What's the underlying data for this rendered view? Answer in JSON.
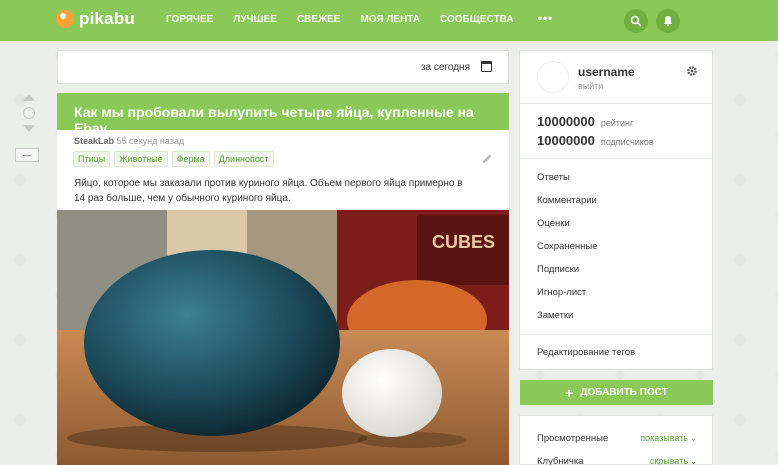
{
  "header": {
    "logo_text": "pikabu",
    "nav": [
      "ГОРЯЧЕЕ",
      "ЛУЧШЕЕ",
      "СВЕЖЕЕ",
      "МОЯ ЛЕНТА",
      "СООБЩЕСТВА"
    ],
    "nav_active": "СВЕЖЕЕ",
    "more": "•••",
    "accent_color": "#8ac858"
  },
  "datebar": {
    "label": "за сегодня",
    "icon": "calendar-icon"
  },
  "post": {
    "title": "Как мы пробовали вылупить четыре яйца, купленные на Ebay",
    "author": "SteakLab",
    "time": "55 секунд назад",
    "tags": [
      "Птицы",
      "Животные",
      "Ферма",
      "Длиннопост"
    ],
    "text": "Яйцо, которое мы заказали против куриного яйца. Объем первого яйца примерно в 14 раз больше, чем у обычного куриного яйца.",
    "image_sign": "CUBES"
  },
  "profile": {
    "username": "username",
    "logout": "выйти",
    "rating_value": "10000000",
    "rating_label": "рейтинг",
    "subs_value": "10000000",
    "subs_label": "подписчиков",
    "menu": [
      "Ответы",
      "Комментарии",
      "Оценки",
      "Сохраненные",
      "Подписки",
      "Игнор-лист",
      "Заметки"
    ],
    "tags_edit": "Редактирование тегов"
  },
  "add_post": {
    "plus": "+",
    "label": "ДОБАВИТЬ ПОСТ"
  },
  "filters": [
    {
      "label": "Просмотренные",
      "value": "показывать"
    },
    {
      "label": "Клубничка",
      "value": "скрывать"
    }
  ]
}
